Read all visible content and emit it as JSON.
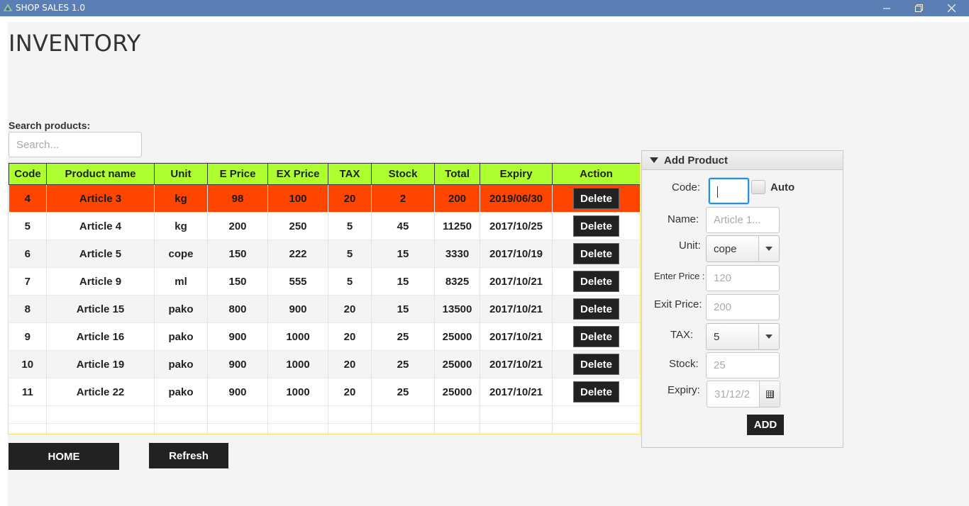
{
  "window": {
    "title": "SHOP SALES 1.0",
    "accent_color": "#5b7fb5"
  },
  "page": {
    "title": "INVENTORY"
  },
  "search": {
    "label": "Search products:",
    "placeholder": "Search..."
  },
  "table": {
    "columns": [
      "Code",
      "Product name",
      "Unit",
      "E Price",
      "EX Price",
      "TAX",
      "Stock",
      "Total",
      "Expiry",
      "Action"
    ],
    "header_color": "#adff2f",
    "selected_color": "#ff4500",
    "rows": [
      {
        "code": "4",
        "name": "Article 3",
        "unit": "kg",
        "eprice": "98",
        "exprice": "100",
        "tax": "20",
        "stock": "2",
        "total": "200",
        "expiry": "2019/06/30",
        "action": "Delete",
        "selected": true
      },
      {
        "code": "5",
        "name": "Article 4",
        "unit": "kg",
        "eprice": "200",
        "exprice": "250",
        "tax": "5",
        "stock": "45",
        "total": "11250",
        "expiry": "2017/10/25",
        "action": "Delete"
      },
      {
        "code": "6",
        "name": "Article 5",
        "unit": "cope",
        "eprice": "150",
        "exprice": "222",
        "tax": "5",
        "stock": "15",
        "total": "3330",
        "expiry": "2017/10/19",
        "action": "Delete"
      },
      {
        "code": "7",
        "name": "Article 9",
        "unit": "ml",
        "eprice": "150",
        "exprice": "555",
        "tax": "5",
        "stock": "15",
        "total": "8325",
        "expiry": "2017/10/21",
        "action": "Delete"
      },
      {
        "code": "8",
        "name": "Article 15",
        "unit": "pako",
        "eprice": "800",
        "exprice": "900",
        "tax": "20",
        "stock": "15",
        "total": "13500",
        "expiry": "2017/10/21",
        "action": "Delete"
      },
      {
        "code": "9",
        "name": "Article 16",
        "unit": "pako",
        "eprice": "900",
        "exprice": "1000",
        "tax": "20",
        "stock": "25",
        "total": "25000",
        "expiry": "2017/10/21",
        "action": "Delete"
      },
      {
        "code": "10",
        "name": "Article 19",
        "unit": "pako",
        "eprice": "900",
        "exprice": "1000",
        "tax": "20",
        "stock": "25",
        "total": "25000",
        "expiry": "2017/10/21",
        "action": "Delete"
      },
      {
        "code": "11",
        "name": "Article 22",
        "unit": "pako",
        "eprice": "900",
        "exprice": "1000",
        "tax": "20",
        "stock": "25",
        "total": "25000",
        "expiry": "2017/10/21",
        "action": "Delete"
      }
    ]
  },
  "buttons": {
    "home": "HOME",
    "refresh": "Refresh"
  },
  "add_panel": {
    "title": "Add Product",
    "code_label": "Code:",
    "code_value": "",
    "auto_label": "Auto",
    "name_label": "Name:",
    "name_placeholder": "Article 1...",
    "unit_label": "Unit:",
    "unit_value": "cope",
    "enter_price_label": "Enter Price :",
    "enter_price_placeholder": "120",
    "exit_price_label": "Exit Price:",
    "exit_price_placeholder": "200",
    "tax_label": "TAX:",
    "tax_value": "5",
    "stock_label": "Stock:",
    "stock_placeholder": "25",
    "expiry_label": "Expiry:",
    "expiry_placeholder": "31/12/2",
    "add_label": "ADD"
  }
}
